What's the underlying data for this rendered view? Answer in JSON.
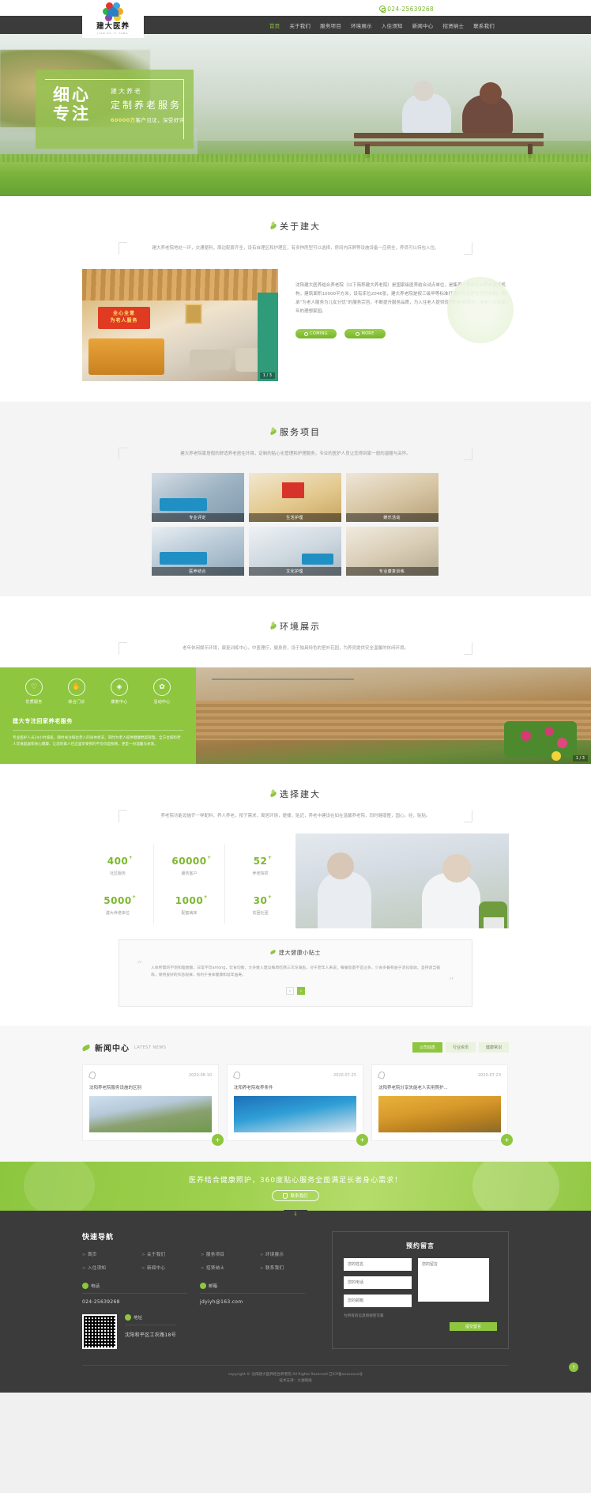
{
  "header": {
    "phone": "024-25639268",
    "logo_name": "建大医养",
    "logo_pinyin": "JIAN DA YI YANG",
    "nav": [
      {
        "label": "首页",
        "active": true
      },
      {
        "label": "关于我们",
        "active": false
      },
      {
        "label": "服务项目",
        "active": false
      },
      {
        "label": "环境展示",
        "active": false
      },
      {
        "label": "入住须知",
        "active": false
      },
      {
        "label": "新闻中心",
        "active": false
      },
      {
        "label": "招贤纳士",
        "active": false
      },
      {
        "label": "联系我们",
        "active": false
      }
    ]
  },
  "hero": {
    "big_line1": "细心",
    "big_line2": "专注",
    "small_top": "建大养老",
    "small_main": "定制养老服务",
    "highlight": "60000万",
    "small_sub": "客户见证，深受好评"
  },
  "about": {
    "title": "关于建大",
    "desc": "建大养老院地处一环，交通便利，周边配套齐全，设有自理区和护理区，有多种房型可以选择，房间内床屏等设施设备一应俱全，养员可以持包入住。",
    "body": "沈阳建大医养结合养老院（以下简称建大养老院）是国家级医养结合试点单位，是集养一体的专业养老服务机构，建筑面积10000平方米，设有床位2046张，建大养老院是按三级甲等标准打造的专业养老服务机构。秉承“为老人服务为儿女分忧”的服务宗旨，不断提升服务品质，为入住老人提供优质的养老服务，是老人安享晚年的理想家园。",
    "btn1": "COMING",
    "btn2": "MORE",
    "img_counter": "1 / 3"
  },
  "services": {
    "title": "服务项目",
    "desc": "建大养老院家居般的舒适养老居住环境，定制的贴心化管理和护理服务，专业的医护人员让您得到家一般的温暖与关怀。",
    "items": [
      {
        "label": "专业评定"
      },
      {
        "label": "生活护理"
      },
      {
        "label": "娱乐活动"
      },
      {
        "label": "医养结合"
      },
      {
        "label": "文化护理"
      },
      {
        "label": "专业康复训练"
      }
    ]
  },
  "environment": {
    "title": "环境展示",
    "desc": "老年休闲娱乐环境，康复训练中心，中医理疗，健身房，设于独具特色的室外花园，为养员提供安全温馨的休闲环境。",
    "icons": [
      {
        "glyph": "♡",
        "label": "优质服务"
      },
      {
        "glyph": "✋",
        "label": "综合门诊"
      },
      {
        "glyph": "◈",
        "label": "康复中心"
      },
      {
        "glyph": "✿",
        "label": "活动中心"
      }
    ],
    "headline": "建大专注回家养老服务",
    "body": "专业医护人员24小时值班，随时关注每位老人的身体状况，同时为老人提供健康档案管理，全方位照料老人饮食起居和身心健康，让您的家人在这里享受到的不仅仅是照顾，更是一份温暖与关爱。",
    "img_counter": "1 / 3"
  },
  "choose": {
    "title": "选择建大",
    "desc": "养老院功能设施齐一样配料，养人养老，按子需求，寓居环境，便捷，贴近，养老中建设在如在温馨养老院，同时健康整，国心。经，贴贴。",
    "stats": [
      {
        "value": "400",
        "sup": "+",
        "label": "社区服务"
      },
      {
        "value": "60000",
        "sup": "+",
        "label": "服务客户"
      },
      {
        "value": "52",
        "sup": "+",
        "label": "养老院项"
      },
      {
        "value": "5000",
        "sup": "+",
        "label": "建大养老床位"
      },
      {
        "value": "1000",
        "sup": "+",
        "label": "配套病床"
      },
      {
        "value": "30",
        "sup": "+",
        "label": "贫困社团"
      }
    ],
    "tip_title": "建大健康小贴士",
    "tip_body": "人体所需的不饱和脂肪酸，日常不饮among，饮食均衡，大多数人建议每周吃两三次深海鱼。对于老年人来说，每餐饭量不宜过多，少食多餐有益于消化吸收。坚持适当锻炼，保持良好的作息规律，有利于身体健康和延年益寿。",
    "tip_prev": "‹",
    "tip_next": "›"
  },
  "news": {
    "title": "新闻中心",
    "title_en": "LATEST NEWS",
    "tabs": [
      {
        "label": "公司动态",
        "active": true
      },
      {
        "label": "行业资讯",
        "active": false
      },
      {
        "label": "健康常识",
        "active": false
      }
    ],
    "items": [
      {
        "date": "2020-08-10",
        "title": "沈阳养老院服务设施的区别",
        "badge": "+"
      },
      {
        "date": "2020-07-25",
        "title": "沈阳养老院收养条件",
        "badge": "+"
      },
      {
        "date": "2020-07-23",
        "title": "沈阳养老院分享失能老人实用照护...",
        "badge": "+"
      }
    ]
  },
  "cta": {
    "text": "医养结合健康照护，360度贴心服务全面满足长者身心需求！",
    "button": "联系我们"
  },
  "footer": {
    "nav_title": "快速导航",
    "nav": [
      "首页",
      "关于我们",
      "服务项目",
      "环境展示",
      "入住须知",
      "新闻中心",
      "招贤纳士",
      "联系我们"
    ],
    "phone_label": "电话",
    "phone_value": "024-25639268",
    "email_label": "邮箱",
    "email_value": "jdyiyh@163.com",
    "addr_label": "地址",
    "addr_value": "沈阳和平区工农路18号",
    "form_title": "预约留言",
    "field_name": "您的姓名",
    "field_phone": "您的电话",
    "field_email": "您的邮箱",
    "field_msg": "您的留言",
    "form_note": "为所有的信息和保密可靠",
    "submit": "提交留言",
    "copyright": "copyright © 沈阳建大医养结合养老院 All Rights Reserved 辽ICP备xxxxxxxx号",
    "copyright2": "技术支持：大潮网络",
    "backtop": "↑"
  }
}
